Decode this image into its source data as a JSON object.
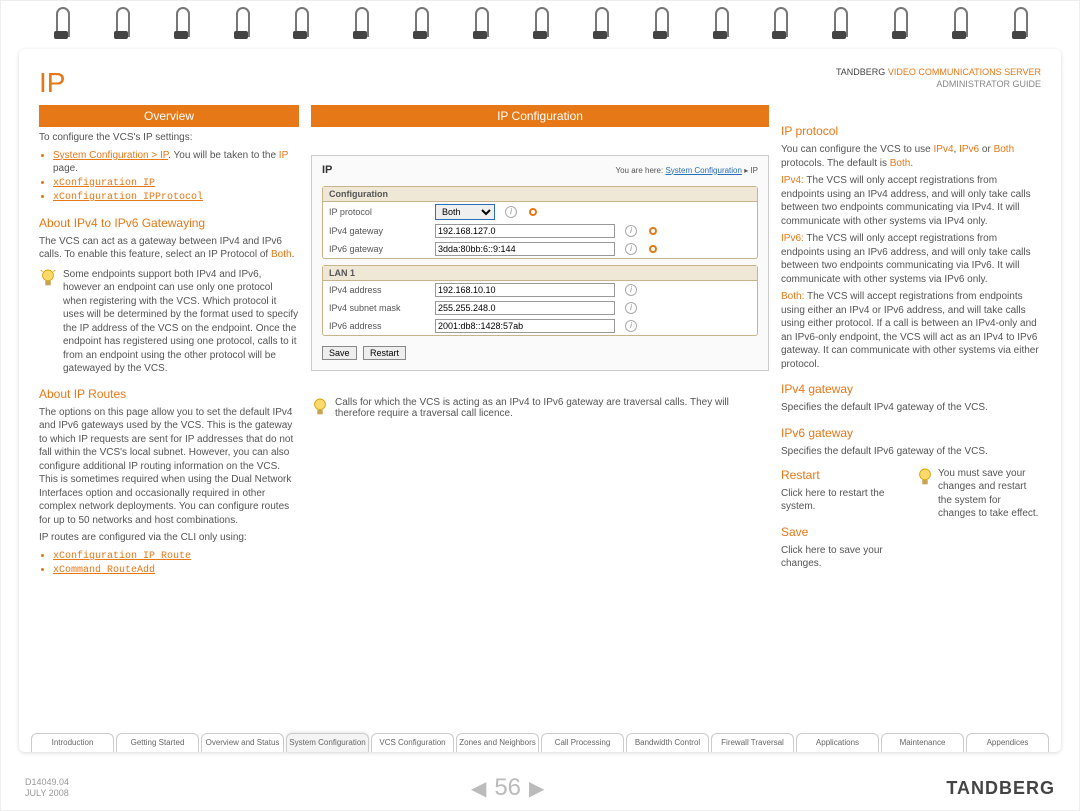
{
  "page": {
    "title": "IP",
    "brand_pre": "TANDBERG",
    "brand_mid": "VIDEO COMMUNICATIONS SERVER",
    "brand_sub": "ADMINISTRATOR GUIDE"
  },
  "overview": {
    "header": "Overview",
    "intro": "To configure the VCS's IP settings:",
    "bullets": {
      "b1a": "System Configuration > IP",
      "b1b": ". You will be taken to the ",
      "b1c": "IP",
      "b1d": " page.",
      "b2": "xConfiguration IP",
      "b3": "xConfiguration IPProtocol"
    },
    "gw_h": "About IPv4 to IPv6 Gatewaying",
    "gw_p": "The VCS can act as a gateway between IPv4 and IPv6 calls.  To enable this feature, select an IP Protocol of ",
    "gw_both": "Both",
    "gw_dot": ".",
    "tip": "Some endpoints support both IPv4 and IPv6, however an endpoint can use only one protocol when registering with the VCS.  Which protocol it uses will be determined by the format used to specify the IP address of the VCS on the endpoint.  Once the endpoint has registered using one protocol, calls to it from an endpoint using the other protocol will be gatewayed by the VCS.",
    "routes_h": "About IP Routes",
    "routes_p": "The options on this page allow you to set the default IPv4 and IPv6 gateways used by the VCS.  This is the gateway to which IP requests are sent for IP addresses that do not fall within the VCS's local subnet.  However, you can also configure  additional IP routing information on the VCS. This is sometimes required when using the Dual Network Interfaces option and occasionally required in other complex network deployments. You can configure routes for up to 50 networks and host combinations.",
    "routes_p2": "IP routes are configured via the CLI only using:",
    "rb1": "xConfiguration IP Route",
    "rb2": "xCommand RouteAdd"
  },
  "midcol": {
    "header": "IP Configuration",
    "ui": {
      "title": "IP",
      "yah_pre": "You are here:",
      "yah_link": "System Configuration",
      "yah_sep": "▸",
      "yah_cur": "IP",
      "configbox": "Configuration",
      "lbl_proto": "IP protocol",
      "sel_proto": "Both",
      "lbl_v4gw": "IPv4 gateway",
      "val_v4gw": "192.168.127.0",
      "lbl_v6gw": "IPv6 gateway",
      "val_v6gw": "3dda:80bb:6::9:144",
      "lanbox": "LAN 1",
      "lbl_v4addr": "IPv4 address",
      "val_v4addr": "192.168.10.10",
      "lbl_v4mask": "IPv4 subnet mask",
      "val_v4mask": "255.255.248.0",
      "lbl_v6addr": "IPv6 address",
      "val_v6addr": "2001:db8::1428:57ab",
      "btn_save": "Save",
      "btn_restart": "Restart"
    },
    "calltip": "Calls for which the VCS is acting as an IPv4 to IPv6 gateway are traversal calls.  They will therefore require a traversal call licence."
  },
  "right": {
    "proto_h": "IP protocol",
    "proto_p1a": "You can configure the VCS to use ",
    "proto_ipv4": "IPv4",
    "proto_sep": ", ",
    "proto_ipv6": "IPv6",
    "proto_p1b": " or ",
    "proto_both": "Both",
    "proto_p1c": " protocols. The default is ",
    "proto_p1d": ".",
    "ipv4_l": "IPv4:",
    "ipv4_t": " The VCS will only accept registrations from endpoints using an IPv4 address, and will only take calls between two endpoints communicating via IPv4.  It will communicate with other systems via IPv4 only.",
    "ipv6_l": "IPv6:",
    "ipv6_t": " The VCS will only accept registrations from endpoints using an IPv6 address, and will only take calls between two endpoints communicating via IPv6.  It will communicate with other systems via IPv6 only.",
    "both_l": "Both:",
    "both_t": " The VCS will accept registrations from endpoints using either an IPv4 or IPv6 address, and will take calls using either protocol.  If a call is between an IPv4-only and an IPv6-only endpoint, the VCS will act as an IPv4 to IPv6 gateway. It can communicate with other systems via either protocol.",
    "v4gw_h": "IPv4 gateway",
    "v4gw_t": "Specifies the default IPv4 gateway of the VCS.",
    "v6gw_h": "IPv6 gateway",
    "v6gw_t": "Specifies the default IPv6 gateway of the VCS.",
    "restart_h": "Restart",
    "restart_t": "Click here to restart the system.",
    "save_h": "Save",
    "save_t": "Click here to save your changes.",
    "rtip": "You must save your changes and restart the system for changes to take effect."
  },
  "tabs": [
    "Introduction",
    "Getting Started",
    "Overview and Status",
    "System Configuration",
    "VCS Configuration",
    "Zones and Neighbors",
    "Call Processing",
    "Bandwidth Control",
    "Firewall Traversal",
    "Applications",
    "Maintenance",
    "Appendices"
  ],
  "active_tab_index": 3,
  "footer": {
    "docid": "D14049.04",
    "date": "JULY 2008",
    "page": "56",
    "brand": "TANDBERG"
  }
}
